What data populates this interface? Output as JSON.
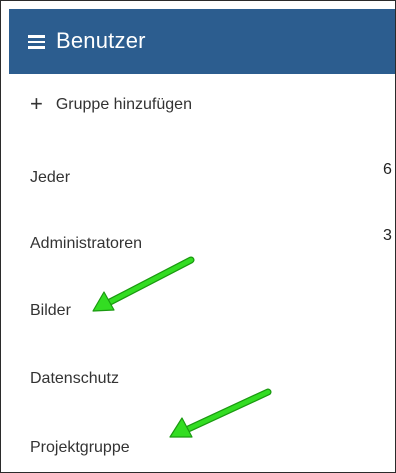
{
  "header": {
    "title": "Benutzer",
    "menu_icon": "hamburger-icon",
    "background": "#2c5d8f"
  },
  "actions": {
    "add_group_label": "Gruppe hinzufügen",
    "add_group_icon": "plus-icon"
  },
  "groups": [
    {
      "label": "Jeder",
      "count": "6"
    },
    {
      "label": "Administratoren",
      "count": "3"
    },
    {
      "label": "Bilder",
      "count": ""
    },
    {
      "label": "Datenschutz",
      "count": ""
    },
    {
      "label": "Projektgruppe",
      "count": ""
    }
  ],
  "annotations": {
    "arrow_color": "#33dd22",
    "arrow_targets": [
      "Bilder",
      "Projektgruppe"
    ]
  }
}
